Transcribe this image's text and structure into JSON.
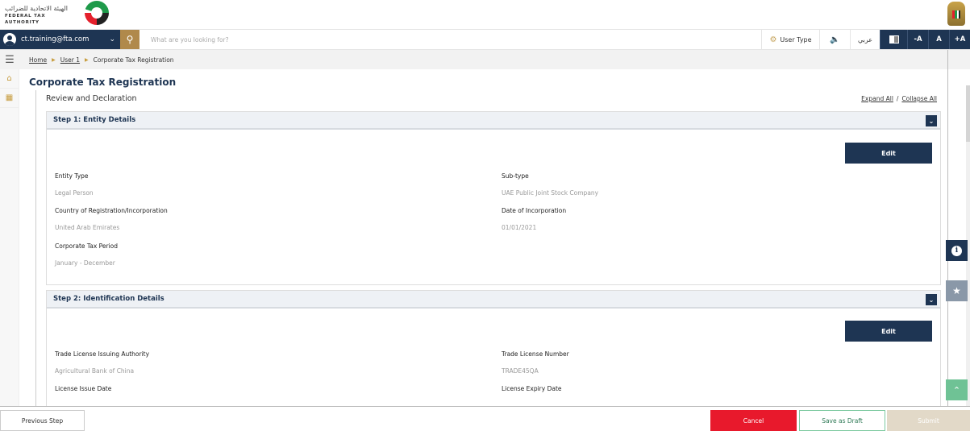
{
  "header": {
    "logo_ar": "الهيئة الاتحادية للضرائب",
    "logo_en": "FEDERAL TAX AUTHORITY"
  },
  "nav": {
    "user_email": "ct.training@fta.com",
    "search_placeholder": "What are you looking for?",
    "user_type_label": "User Type",
    "sound_icon": "🔈)",
    "arabic_label": "عربي",
    "font_decrease": "-A",
    "font_normal": "A",
    "font_increase": "+A"
  },
  "breadcrumb": {
    "items": [
      "Home",
      "User 1",
      "Corporate Tax Registration"
    ]
  },
  "page": {
    "title": "Corporate Tax Registration",
    "section_title": "Review and Declaration",
    "expand_all": "Expand All",
    "separator": "/",
    "collapse_all": "Collapse All"
  },
  "steps": [
    {
      "title": "Step 1: Entity Details",
      "edit_label": "Edit",
      "fields": [
        {
          "label": "Entity Type",
          "value": "Legal Person"
        },
        {
          "label": "Sub-type",
          "value": "UAE Public Joint Stock Company"
        },
        {
          "label": "Country of Registration/Incorporation",
          "value": "United Arab Emirates"
        },
        {
          "label": "Date of Incorporation",
          "value": "01/01/2021"
        },
        {
          "label": "Corporate Tax Period",
          "value": "January - December"
        }
      ]
    },
    {
      "title": "Step 2: Identification Details",
      "edit_label": "Edit",
      "fields": [
        {
          "label": "Trade License Issuing Authority",
          "value": "Agricultural Bank of China"
        },
        {
          "label": "Trade License Number",
          "value": "TRADE45QA"
        },
        {
          "label": "License Issue Date",
          "value": ""
        },
        {
          "label": "License Expiry Date",
          "value": ""
        }
      ]
    }
  ],
  "footer": {
    "previous_label": "Previous Step",
    "cancel_label": "Cancel",
    "draft_label": "Save as Draft",
    "submit_label": "Submit"
  },
  "colors": {
    "primary": "#1e3553",
    "gold": "#b0894b",
    "cancel": "#e8192c",
    "draft_border": "#7cc9a0",
    "submit_disabled": "#e2d9c8"
  }
}
